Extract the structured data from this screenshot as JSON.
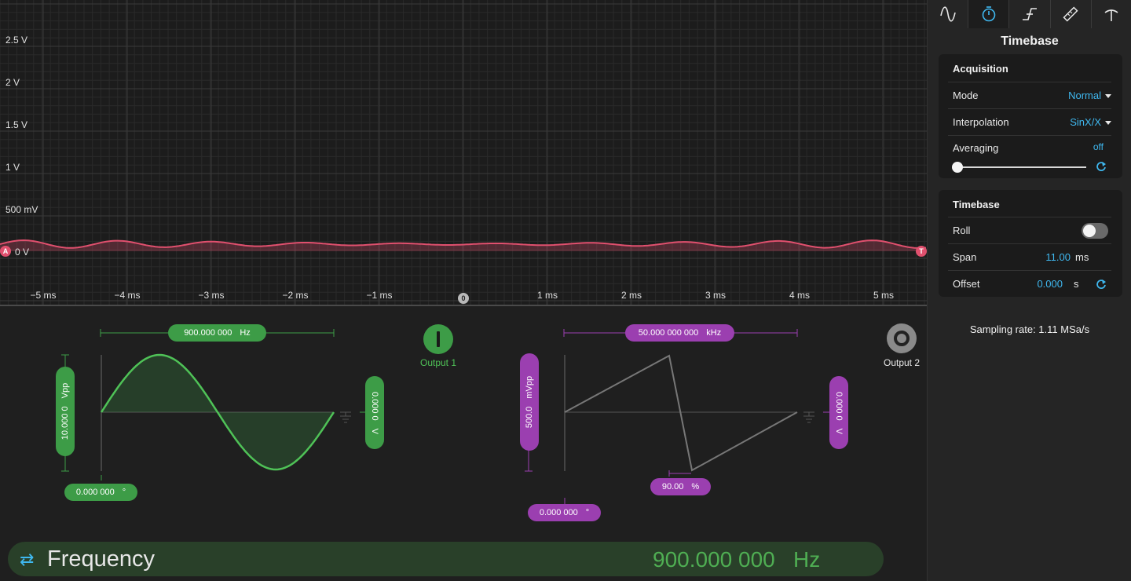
{
  "scope": {
    "y_labels": [
      "2.5 V",
      "2 V",
      "1.5 V",
      "1 V",
      "500 mV",
      "0 V"
    ],
    "x_labels": [
      "−5 ms",
      "−4 ms",
      "−3 ms",
      "−2 ms",
      "−1 ms",
      "1 ms",
      "2 ms",
      "3 ms",
      "4 ms",
      "5 ms"
    ],
    "channel_marker": "A",
    "trigger_marker": "T",
    "zero_marker": "0",
    "trace_color": "#e0506e"
  },
  "generator": {
    "output1": {
      "label": "Output 1",
      "frequency_value": "900.000 000",
      "frequency_unit": "Hz",
      "amplitude_value": "10.000 0",
      "amplitude_unit": "Vpp",
      "offset_value": "0.000 0",
      "offset_unit": "V",
      "phase_value": "0.000 000",
      "phase_unit": "°",
      "waveform": "sine",
      "color": "#3d9c47",
      "state": "on"
    },
    "output2": {
      "label": "Output 2",
      "frequency_value": "50.000 000 000",
      "frequency_unit": "kHz",
      "amplitude_value": "500.0",
      "amplitude_unit": "mVpp",
      "offset_value": "0.000 0",
      "offset_unit": "V",
      "phase_value": "0.000 000",
      "phase_unit": "°",
      "symmetry_value": "90.00",
      "symmetry_unit": "%",
      "waveform": "sawtooth",
      "color": "#9b3fb0",
      "state": "off"
    },
    "freq_bar": {
      "label": "Frequency",
      "value": "900.000 000",
      "unit": "Hz"
    }
  },
  "panel": {
    "tabs": [
      "sine-wave-icon",
      "stopwatch-icon",
      "trigger-edge-icon",
      "ruler-icon",
      "antenna-icon"
    ],
    "active_tab": 1,
    "title": "Timebase",
    "acquisition": {
      "title": "Acquisition",
      "mode_label": "Mode",
      "mode_value": "Normal",
      "interpolation_label": "Interpolation",
      "interpolation_value": "SinX/X",
      "averaging_label": "Averaging",
      "averaging_value": "off"
    },
    "timebase": {
      "title": "Timebase",
      "roll_label": "Roll",
      "roll_on": false,
      "span_label": "Span",
      "span_value": "11.00",
      "span_unit": "ms",
      "offset_label": "Offset",
      "offset_value": "0.000",
      "offset_unit": "s"
    },
    "sampling_rate": "Sampling rate: 1.11 MSa/s"
  }
}
